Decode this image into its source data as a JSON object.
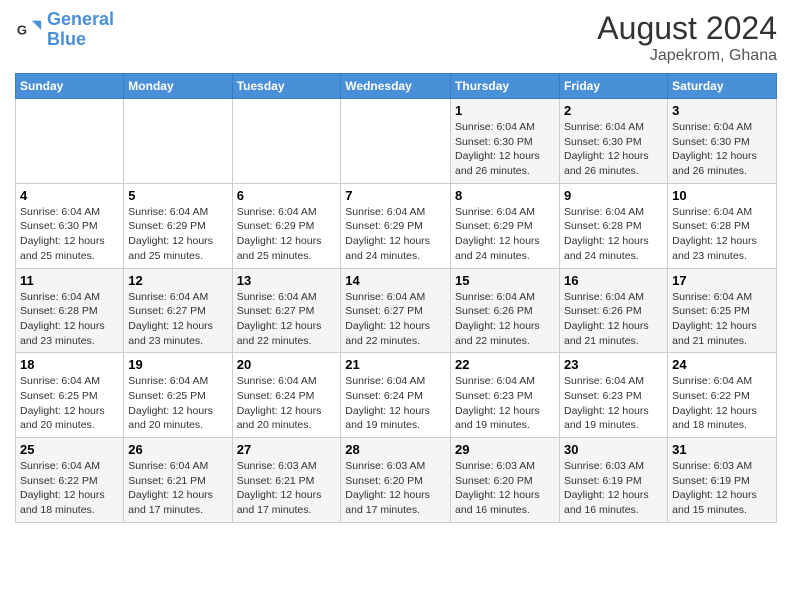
{
  "logo": {
    "name_part1": "General",
    "name_part2": "Blue"
  },
  "title": "August 2024",
  "subtitle": "Japekrom, Ghana",
  "days_of_week": [
    "Sunday",
    "Monday",
    "Tuesday",
    "Wednesday",
    "Thursday",
    "Friday",
    "Saturday"
  ],
  "weeks": [
    [
      {
        "day": "",
        "info": ""
      },
      {
        "day": "",
        "info": ""
      },
      {
        "day": "",
        "info": ""
      },
      {
        "day": "",
        "info": ""
      },
      {
        "day": "1",
        "info": "Sunrise: 6:04 AM\nSunset: 6:30 PM\nDaylight: 12 hours\nand 26 minutes."
      },
      {
        "day": "2",
        "info": "Sunrise: 6:04 AM\nSunset: 6:30 PM\nDaylight: 12 hours\nand 26 minutes."
      },
      {
        "day": "3",
        "info": "Sunrise: 6:04 AM\nSunset: 6:30 PM\nDaylight: 12 hours\nand 26 minutes."
      }
    ],
    [
      {
        "day": "4",
        "info": "Sunrise: 6:04 AM\nSunset: 6:30 PM\nDaylight: 12 hours\nand 25 minutes."
      },
      {
        "day": "5",
        "info": "Sunrise: 6:04 AM\nSunset: 6:29 PM\nDaylight: 12 hours\nand 25 minutes."
      },
      {
        "day": "6",
        "info": "Sunrise: 6:04 AM\nSunset: 6:29 PM\nDaylight: 12 hours\nand 25 minutes."
      },
      {
        "day": "7",
        "info": "Sunrise: 6:04 AM\nSunset: 6:29 PM\nDaylight: 12 hours\nand 24 minutes."
      },
      {
        "day": "8",
        "info": "Sunrise: 6:04 AM\nSunset: 6:29 PM\nDaylight: 12 hours\nand 24 minutes."
      },
      {
        "day": "9",
        "info": "Sunrise: 6:04 AM\nSunset: 6:28 PM\nDaylight: 12 hours\nand 24 minutes."
      },
      {
        "day": "10",
        "info": "Sunrise: 6:04 AM\nSunset: 6:28 PM\nDaylight: 12 hours\nand 23 minutes."
      }
    ],
    [
      {
        "day": "11",
        "info": "Sunrise: 6:04 AM\nSunset: 6:28 PM\nDaylight: 12 hours\nand 23 minutes."
      },
      {
        "day": "12",
        "info": "Sunrise: 6:04 AM\nSunset: 6:27 PM\nDaylight: 12 hours\nand 23 minutes."
      },
      {
        "day": "13",
        "info": "Sunrise: 6:04 AM\nSunset: 6:27 PM\nDaylight: 12 hours\nand 22 minutes."
      },
      {
        "day": "14",
        "info": "Sunrise: 6:04 AM\nSunset: 6:27 PM\nDaylight: 12 hours\nand 22 minutes."
      },
      {
        "day": "15",
        "info": "Sunrise: 6:04 AM\nSunset: 6:26 PM\nDaylight: 12 hours\nand 22 minutes."
      },
      {
        "day": "16",
        "info": "Sunrise: 6:04 AM\nSunset: 6:26 PM\nDaylight: 12 hours\nand 21 minutes."
      },
      {
        "day": "17",
        "info": "Sunrise: 6:04 AM\nSunset: 6:25 PM\nDaylight: 12 hours\nand 21 minutes."
      }
    ],
    [
      {
        "day": "18",
        "info": "Sunrise: 6:04 AM\nSunset: 6:25 PM\nDaylight: 12 hours\nand 20 minutes."
      },
      {
        "day": "19",
        "info": "Sunrise: 6:04 AM\nSunset: 6:25 PM\nDaylight: 12 hours\nand 20 minutes."
      },
      {
        "day": "20",
        "info": "Sunrise: 6:04 AM\nSunset: 6:24 PM\nDaylight: 12 hours\nand 20 minutes."
      },
      {
        "day": "21",
        "info": "Sunrise: 6:04 AM\nSunset: 6:24 PM\nDaylight: 12 hours\nand 19 minutes."
      },
      {
        "day": "22",
        "info": "Sunrise: 6:04 AM\nSunset: 6:23 PM\nDaylight: 12 hours\nand 19 minutes."
      },
      {
        "day": "23",
        "info": "Sunrise: 6:04 AM\nSunset: 6:23 PM\nDaylight: 12 hours\nand 19 minutes."
      },
      {
        "day": "24",
        "info": "Sunrise: 6:04 AM\nSunset: 6:22 PM\nDaylight: 12 hours\nand 18 minutes."
      }
    ],
    [
      {
        "day": "25",
        "info": "Sunrise: 6:04 AM\nSunset: 6:22 PM\nDaylight: 12 hours\nand 18 minutes."
      },
      {
        "day": "26",
        "info": "Sunrise: 6:04 AM\nSunset: 6:21 PM\nDaylight: 12 hours\nand 17 minutes."
      },
      {
        "day": "27",
        "info": "Sunrise: 6:03 AM\nSunset: 6:21 PM\nDaylight: 12 hours\nand 17 minutes."
      },
      {
        "day": "28",
        "info": "Sunrise: 6:03 AM\nSunset: 6:20 PM\nDaylight: 12 hours\nand 17 minutes."
      },
      {
        "day": "29",
        "info": "Sunrise: 6:03 AM\nSunset: 6:20 PM\nDaylight: 12 hours\nand 16 minutes."
      },
      {
        "day": "30",
        "info": "Sunrise: 6:03 AM\nSunset: 6:19 PM\nDaylight: 12 hours\nand 16 minutes."
      },
      {
        "day": "31",
        "info": "Sunrise: 6:03 AM\nSunset: 6:19 PM\nDaylight: 12 hours\nand 15 minutes."
      }
    ]
  ]
}
